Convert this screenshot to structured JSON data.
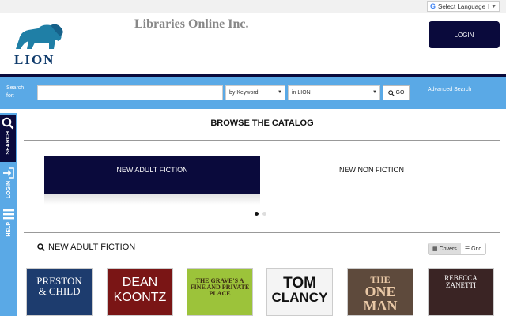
{
  "translate": {
    "label": "Select Language",
    "caret": "▼"
  },
  "header": {
    "logo_text": "LION",
    "site_title": "Libraries Online Inc.",
    "login_label": "LOGIN"
  },
  "search": {
    "label": "Search for:",
    "input_value": "",
    "type_selected": "by Keyword",
    "scope_selected": "in LION",
    "go_label": "GO",
    "advanced_label": "Advanced Search"
  },
  "sidebar": {
    "items": [
      {
        "label": "SEARCH",
        "icon": "search-icon"
      },
      {
        "label": "LOGIN",
        "icon": "login-icon"
      },
      {
        "label": "HELP",
        "icon": "menu-icon"
      }
    ]
  },
  "catalog": {
    "title": "BROWSE THE CATALOG",
    "panels": [
      {
        "label": "NEW ADULT FICTION",
        "active": true
      },
      {
        "label": "NEW NON FICTION",
        "active": false
      }
    ]
  },
  "section": {
    "title": "NEW ADULT FICTION",
    "view_covers": "Covers",
    "view_grid": "Grid"
  },
  "books": [
    {
      "title_line1": "PRESTON",
      "title_line2": "& CHILD",
      "bg": "#1d3c6e",
      "fg": "#ffffff"
    },
    {
      "title_line1": "DEAN",
      "title_line2": "KOONTZ",
      "bg": "#7a1515",
      "fg": "#ffffff"
    },
    {
      "title_line1": "THE GRAVE'S A",
      "title_line2": "FINE AND PRIVATE PLACE",
      "bg": "#9cc33a",
      "fg": "#3d2b14"
    },
    {
      "title_line1": "TOM",
      "title_line2": "CLANCY",
      "bg": "#f4f4f4",
      "fg": "#111111"
    },
    {
      "title_line1": "THE",
      "title_line2": "ONE MAN",
      "bg": "#5e4a3c",
      "fg": "#e9c8a6"
    },
    {
      "title_line1": "REBECCA",
      "title_line2": "ZANETTI",
      "bg": "#3a2424",
      "fg": "#ffffff"
    }
  ],
  "colors": {
    "navy": "#0a0a3c",
    "search_bar": "#5aa9e6"
  }
}
